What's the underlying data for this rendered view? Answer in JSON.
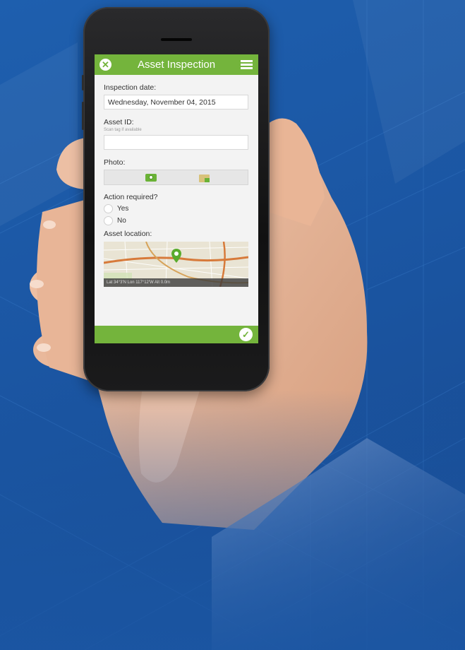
{
  "colors": {
    "accent": "#74b43c",
    "background": "#1b56a3"
  },
  "app": {
    "title": "Asset Inspection",
    "close_icon": "close-icon",
    "menu_icon": "hamburger-menu-icon",
    "submit_icon": "checkmark-icon"
  },
  "form": {
    "inspection_date": {
      "label": "Inspection date:",
      "value": "Wednesday, November 04, 2015"
    },
    "asset_id": {
      "label": "Asset ID:",
      "hint": "Scan tag if available",
      "value": ""
    },
    "photo": {
      "label": "Photo:",
      "camera_icon": "camera-icon",
      "folder_icon": "folder-icon"
    },
    "action_required": {
      "label": "Action required?",
      "options": [
        "Yes",
        "No"
      ]
    },
    "asset_location": {
      "label": "Asset location:",
      "coords": "Lat 34°3'N Lon 117°12'W Alt 0.0m",
      "pin_icon": "map-pin-icon"
    }
  }
}
